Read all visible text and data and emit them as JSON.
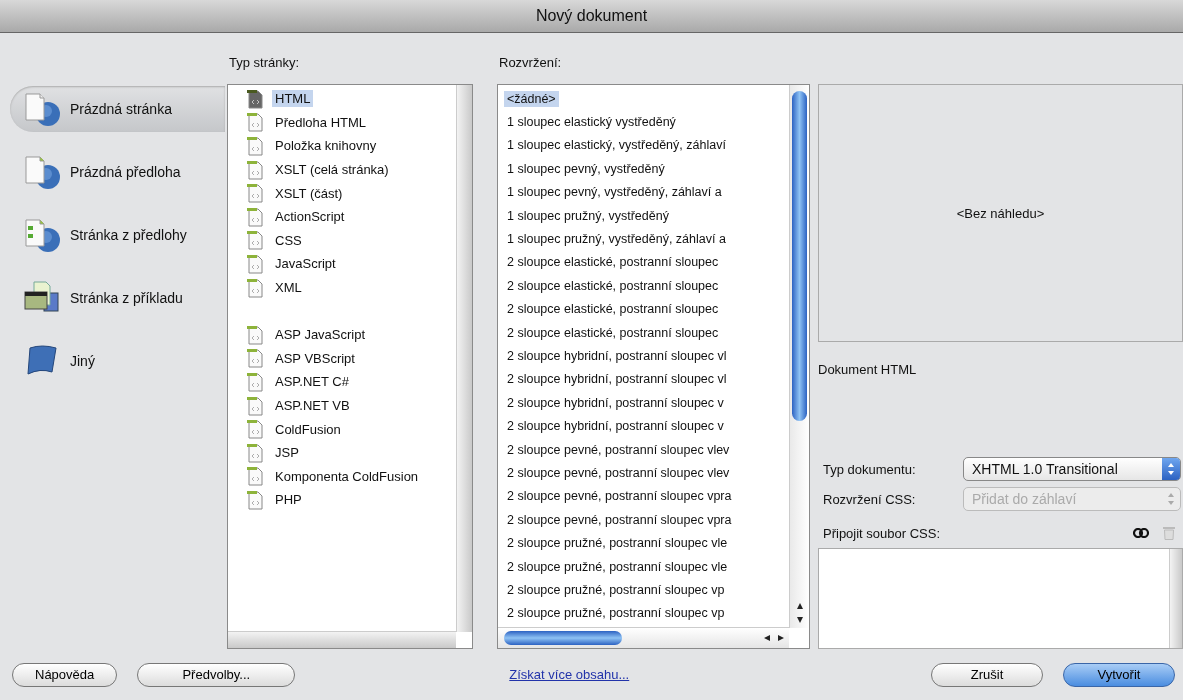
{
  "window": {
    "title": "Nový dokument"
  },
  "sidebar": {
    "items": [
      {
        "label": "Prázdná stránka",
        "kind": "blank-page",
        "selected": true
      },
      {
        "label": "Prázdná předloha",
        "kind": "blank-template",
        "selected": false
      },
      {
        "label": "Stránka z předlohy",
        "kind": "page-from-template",
        "selected": false
      },
      {
        "label": "Stránka z příkladu",
        "kind": "page-from-sample",
        "selected": false
      },
      {
        "label": "Jiný",
        "kind": "other",
        "selected": false
      }
    ]
  },
  "page_type": {
    "label": "Typ stránky:",
    "groups": [
      [
        {
          "label": "HTML",
          "selected": true
        },
        {
          "label": "Předloha HTML",
          "selected": false
        },
        {
          "label": "Položka knihovny",
          "selected": false
        },
        {
          "label": "XSLT (celá stránka)",
          "selected": false
        },
        {
          "label": "XSLT (část)",
          "selected": false
        },
        {
          "label": "ActionScript",
          "selected": false
        },
        {
          "label": "CSS",
          "selected": false
        },
        {
          "label": "JavaScript",
          "selected": false
        },
        {
          "label": "XML",
          "selected": false
        }
      ],
      [
        {
          "label": "ASP JavaScript",
          "selected": false
        },
        {
          "label": "ASP VBScript",
          "selected": false
        },
        {
          "label": "ASP.NET C#",
          "selected": false
        },
        {
          "label": "ASP.NET VB",
          "selected": false
        },
        {
          "label": "ColdFusion",
          "selected": false
        },
        {
          "label": "JSP",
          "selected": false
        },
        {
          "label": "Komponenta ColdFusion",
          "selected": false
        },
        {
          "label": "PHP",
          "selected": false
        }
      ]
    ]
  },
  "layout": {
    "label": "Rozvržení:",
    "items": [
      {
        "label": "<žádné>",
        "selected": true
      },
      {
        "label": "1 sloupec elastický vystředěný",
        "selected": false
      },
      {
        "label": "1 sloupec elastický, vystředěný, záhlaví",
        "selected": false
      },
      {
        "label": "1 sloupec pevný, vystředěný",
        "selected": false
      },
      {
        "label": "1 sloupec pevný, vystředěný, záhlaví a",
        "selected": false
      },
      {
        "label": "1 sloupec pružný, vystředěný",
        "selected": false
      },
      {
        "label": "1 sloupec pružný, vystředěný, záhlaví a",
        "selected": false
      },
      {
        "label": "2 sloupce elastické, postranní sloupec",
        "selected": false
      },
      {
        "label": "2 sloupce elastické, postranní sloupec",
        "selected": false
      },
      {
        "label": "2 sloupce elastické, postranní sloupec",
        "selected": false
      },
      {
        "label": "2 sloupce elastické, postranní sloupec",
        "selected": false
      },
      {
        "label": "2 sloupce hybridní, postranní sloupec vl",
        "selected": false
      },
      {
        "label": "2 sloupce hybridní, postranní sloupec vl",
        "selected": false
      },
      {
        "label": "2 sloupce hybridní, postranní sloupec v",
        "selected": false
      },
      {
        "label": "2 sloupce hybridní, postranní sloupec v",
        "selected": false
      },
      {
        "label": "2 sloupce pevné, postranní sloupec vlev",
        "selected": false
      },
      {
        "label": "2 sloupce pevné, postranní sloupec vlev",
        "selected": false
      },
      {
        "label": "2 sloupce pevné, postranní sloupec vpra",
        "selected": false
      },
      {
        "label": "2 sloupce pevné, postranní sloupec vpra",
        "selected": false
      },
      {
        "label": "2 sloupce pružné, postranní sloupec vle",
        "selected": false
      },
      {
        "label": "2 sloupce pružné, postranní sloupec vle",
        "selected": false
      },
      {
        "label": "2 sloupce pružné, postranní sloupec vp",
        "selected": false
      },
      {
        "label": "2 sloupce pružné, postranní sloupec vp",
        "selected": false
      }
    ]
  },
  "preview": {
    "placeholder": "<Bez náhledu>",
    "description": "Dokument HTML"
  },
  "doc_type": {
    "label": "Typ dokumentu:",
    "value": "XHTML 1.0 Transitional",
    "disabled": false
  },
  "css_layout": {
    "label": "Rozvržení CSS:",
    "value": "Přidat do záhlaví",
    "disabled": true
  },
  "attach_css": {
    "label": "Připojit soubor CSS:"
  },
  "footer": {
    "left_buttons": [
      {
        "label": "Nápověda",
        "default": false
      },
      {
        "label": "Předvolby...",
        "default": false
      }
    ],
    "link": "Získat více obsahu...",
    "right_buttons": [
      {
        "label": "Zrušit",
        "default": false
      },
      {
        "label": "Vytvořit",
        "default": true
      }
    ]
  }
}
